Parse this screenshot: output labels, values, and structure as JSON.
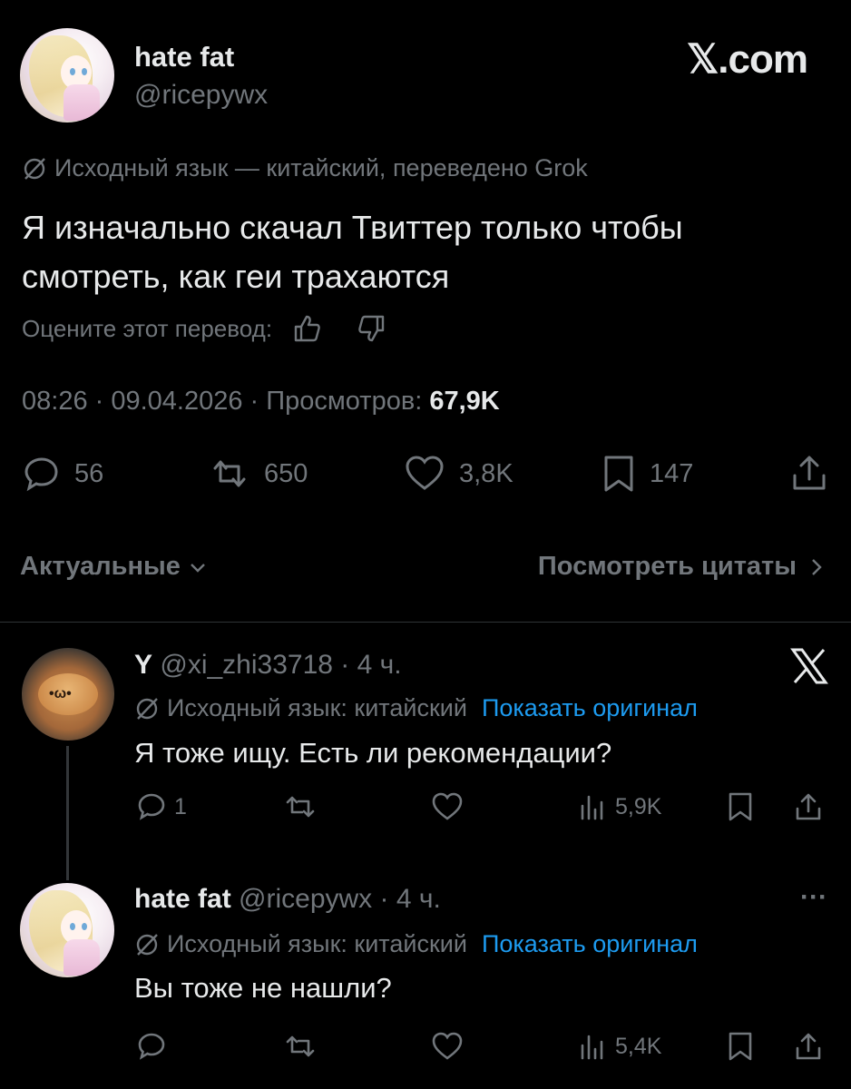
{
  "tweet": {
    "author_name": "hate fat",
    "author_handle": "@ricepywx",
    "site_logo": "𝕏.com",
    "translation_note": "Исходный язык — китайский, переведено Grok",
    "text": "Я изначально скачал Твиттер только чтобы смотреть, как геи трахаются",
    "rate_prompt": "Оцените этот перевод:",
    "time": "08:26 · 09.04.2026 · Просмотров:",
    "views": "67,9K",
    "replies": "56",
    "reposts": "650",
    "likes": "3,8K",
    "bookmarks": "147"
  },
  "filters": {
    "sort_label": "Актуальные",
    "quotes_label": "Посмотреть цитаты"
  },
  "replies": [
    {
      "name": "Y",
      "handle_time": "@xi_zhi33718 · 4 ч.",
      "note": "Исходный язык: китайский",
      "show_original": "Показать оригинал",
      "text": "Я тоже ищу. Есть ли рекомендации?",
      "replies": "1",
      "views": "5,9K",
      "avatar_face": "•ω•"
    },
    {
      "name": "hate fat",
      "handle_time": "@ricepywx · 4 ч.",
      "note": "Исходный язык: китайский",
      "show_original": "Показать оригинал",
      "text": "Вы тоже не нашли?",
      "views": "5,4K",
      "more": "···"
    }
  ],
  "icons": [
    "slash-circle-icon",
    "thumbs-up-icon",
    "thumbs-down-icon",
    "reply-icon",
    "repost-icon",
    "like-icon",
    "bookmark-icon",
    "share-icon",
    "chevron-down-icon",
    "chevron-right-icon",
    "x-logo-icon",
    "views-icon",
    "more-icon"
  ],
  "colors": {
    "background": "#000000",
    "text": "#e7e9ea",
    "muted": "#71767b",
    "link": "#1d9bf0",
    "divider": "#2f3336"
  }
}
